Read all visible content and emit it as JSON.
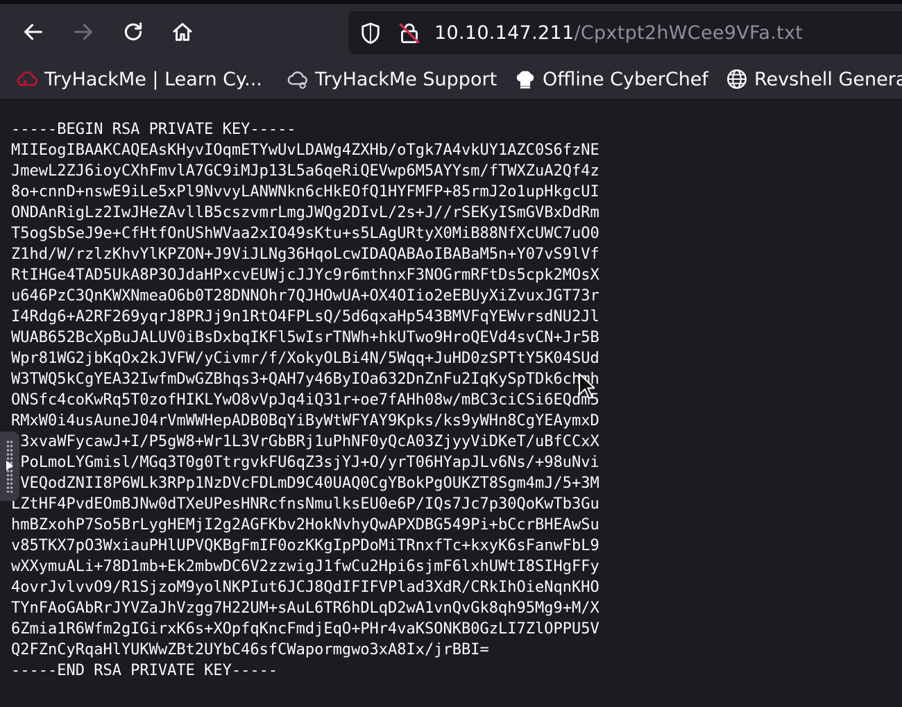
{
  "browser": {
    "url_host": "10.10.147.211",
    "url_path": "/Cpxtpt2hWCee9VFa.txt"
  },
  "bookmarks": [
    {
      "label": "TryHackMe | Learn Cy...",
      "icon": "tryhackme-cloud-icon",
      "color": "#c8102e"
    },
    {
      "label": "TryHackMe Support",
      "icon": "support-cloud-icon",
      "color": "#cfcfd8"
    },
    {
      "label": "Offline CyberChef",
      "icon": "chef-hat-icon",
      "color": "#ffffff"
    },
    {
      "label": "Revshell Genera",
      "icon": "globe-icon",
      "color": "#fbfbfe"
    }
  ],
  "document": {
    "begin": "-----BEGIN RSA PRIVATE KEY-----",
    "lines": [
      "MIIEogIBAAKCAQEAsKHyvIOqmETYwUvLDAWg4ZXHb/oTgk7A4vkUY1AZC0S6fzNE",
      "JmewL2ZJ6ioyCXhFmvlA7GC9iMJp13L5a6qeRiQEVwp6M5AYYsm/fTWXZuA2Qf4z",
      "8o+cnnD+nswE9iLe5xPl9NvvyLANWNkn6cHkEOfQ1HYFMFP+85rmJ2o1upHkgcUI",
      "ONDAnRigLz2IwJHeZAvllB5cszvmrLmgJWQg2DIvL/2s+J//rSEKyISmGVBxDdRm",
      "T5ogSbSeJ9e+CfHtfOnUShWVaa2xIO49sKtu+s5LAgURtyX0MiB88NfXcUWC7uO0",
      "Z1hd/W/rzlzKhvYlKPZON+J9ViJLNg36HqoLcwIDAQABAoIBABaM5n+Y07vS9lVf",
      "RtIHGe4TAD5UkA8P3OJdaHPxcvEUWjcJJYc9r6mthnxF3NOGrmRFtDs5cpk2MOsX",
      "u646PzC3QnKWXNmeaO6b0T28DNNOhr7QJHOwUA+OX4OIio2eEBUyXiZvuxJGT73r",
      "I4Rdg6+A2RF269yqrJ8PRJj9n1RtO4FPLsQ/5d6qxaHp543BMVFqYEWvrsdNU2Jl",
      "WUAB652BcXpBuJALUV0iBsDxbqIKFl5wIsrTNWh+hkUTwo9HroQEVd4svCN+Jr5B",
      "Wpr81WG2jbKqOx2kJVFW/yCivmr/f/XokyOLBi4N/5Wqq+JuHD0zSPTtY5K04SUd",
      "W3TWQ5kCgYEA32IwfmDwGZBhqs3+QAH7y46ByIOa632DnZnFu2IqKySpTDk6chmh",
      "ONSfc4coKwRq5T0zofHIKLYwO8vVpJq4iQ31r+oe7fAHh08w/mBC3ciCSi6EQdm5",
      "RMxW0i4usAuneJ04rVmWWHepADB0BqYiByWtWFYAY9Kpks/ks9yWHn8CgYEAymxD",
      "q3xvaWFycawJ+I/P5gW8+Wr1L3VrGbBRj1uPhNF0yQcA03ZjyyViDKeT/uBfCCxX",
      "LPoLmoLYGmisl/MGq3T0g0TtrgvkFU6qZ3sjYJ+O/yrT06HYapJLv6Ns/+98uNvi",
      "3VEQodZNII8P6WLk3RPp1NzDVcFDLmD9C40UAQ0CgYBokPgOUKZT8Sgm4mJ/5+3M",
      "LZtHF4PvdEOmBJNw0dTXeUPesHNRcfnsNmulksEU0e6P/IQs7Jc7p30QoKwTb3Gu",
      "hmBZxohP7So5BrLygHEMjI2g2AGFKbv2HokNvhyQwAPXDBG549Pi+bCcrBHEAwSu",
      "v85TKX7pO3WxiauPHlUPVQKBgFmIF0ozKKgIpPDoMiTRnxfTc+kxyK6sFanwFbL9",
      "wXXymuALi+78D1mb+Ek2mbwDC6V2zzwigJ1fwCu2Hpi6sjmF6lxhUWtI8SIHgFFy",
      "4ovrJvlvvO9/R1SjzoM9yolNKPIut6JCJ8QdIFIFVPlad3XdR/CRkIhOieNqnKHO",
      "TYnFAoGAbRrJYVZaJhVzgg7H22UM+sAuL6TR6hDLqD2wA1vnQvGk8qh95Mg9+M/X",
      "6Zmia1R6Wfm2gIGirxK6s+XOpfqKncFmdjEqO+PHr4vaKSONKB0GzLI7ZlOPPU5V",
      "Q2FZnCyRqaHlYUKWwZBt2UYbC46sfCWapormgwo3xA8Ix/jrBBI="
    ],
    "end": "-----END RSA PRIVATE KEY-----"
  }
}
